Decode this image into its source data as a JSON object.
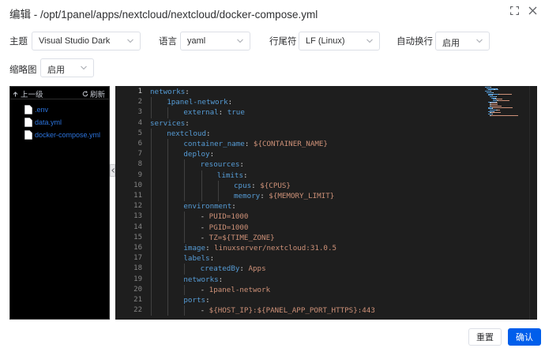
{
  "dialog": {
    "title": "编辑 - /opt/1panel/apps/nextcloud/nextcloud/docker-compose.yml"
  },
  "options": {
    "theme": {
      "label": "主题",
      "value": "Visual Studio Dark"
    },
    "language": {
      "label": "语言",
      "value": "yaml"
    },
    "eol": {
      "label": "行尾符",
      "value": "LF (Linux)"
    },
    "wrap": {
      "label": "自动换行",
      "value": "启用"
    },
    "minimap": {
      "label": "缩略图",
      "value": "启用"
    }
  },
  "tree": {
    "up_label": "上一级",
    "refresh_label": "刷新",
    "files": [
      {
        "name": ".env"
      },
      {
        "name": "data.yml"
      },
      {
        "name": "docker-compose.yml"
      }
    ]
  },
  "editor": {
    "active_line": 1,
    "lines": [
      {
        "no": "1",
        "indent": 0,
        "tokens": [
          {
            "t": "k",
            "v": "networks"
          },
          {
            "t": "p",
            "v": ":"
          }
        ]
      },
      {
        "no": "2",
        "indent": 1,
        "tokens": [
          {
            "t": "k",
            "v": "1panel-network"
          },
          {
            "t": "p",
            "v": ":"
          }
        ]
      },
      {
        "no": "3",
        "indent": 2,
        "tokens": [
          {
            "t": "k",
            "v": "external"
          },
          {
            "t": "p",
            "v": ": "
          },
          {
            "t": "b",
            "v": "true"
          }
        ]
      },
      {
        "no": "4",
        "indent": 0,
        "tokens": [
          {
            "t": "k",
            "v": "services"
          },
          {
            "t": "p",
            "v": ":"
          }
        ]
      },
      {
        "no": "5",
        "indent": 1,
        "tokens": [
          {
            "t": "k",
            "v": "nextcloud"
          },
          {
            "t": "p",
            "v": ":"
          }
        ]
      },
      {
        "no": "6",
        "indent": 2,
        "tokens": [
          {
            "t": "k",
            "v": "container_name"
          },
          {
            "t": "p",
            "v": ": "
          },
          {
            "t": "s",
            "v": "${CONTAINER_NAME}"
          }
        ]
      },
      {
        "no": "7",
        "indent": 2,
        "tokens": [
          {
            "t": "k",
            "v": "deploy"
          },
          {
            "t": "p",
            "v": ":"
          }
        ]
      },
      {
        "no": "8",
        "indent": 3,
        "tokens": [
          {
            "t": "k",
            "v": "resources"
          },
          {
            "t": "p",
            "v": ":"
          }
        ]
      },
      {
        "no": "9",
        "indent": 4,
        "tokens": [
          {
            "t": "k",
            "v": "limits"
          },
          {
            "t": "p",
            "v": ":"
          }
        ]
      },
      {
        "no": "10",
        "indent": 5,
        "tokens": [
          {
            "t": "k",
            "v": "cpus"
          },
          {
            "t": "p",
            "v": ": "
          },
          {
            "t": "s",
            "v": "${CPUS}"
          }
        ]
      },
      {
        "no": "11",
        "indent": 5,
        "tokens": [
          {
            "t": "k",
            "v": "memory"
          },
          {
            "t": "p",
            "v": ": "
          },
          {
            "t": "s",
            "v": "${MEMORY_LIMIT}"
          }
        ]
      },
      {
        "no": "12",
        "indent": 2,
        "tokens": [
          {
            "t": "k",
            "v": "environment"
          },
          {
            "t": "p",
            "v": ":"
          }
        ]
      },
      {
        "no": "13",
        "indent": 3,
        "tokens": [
          {
            "t": "p",
            "v": "- "
          },
          {
            "t": "s",
            "v": "PUID=1000"
          }
        ]
      },
      {
        "no": "14",
        "indent": 3,
        "tokens": [
          {
            "t": "p",
            "v": "- "
          },
          {
            "t": "s",
            "v": "PGID=1000"
          }
        ]
      },
      {
        "no": "15",
        "indent": 3,
        "tokens": [
          {
            "t": "p",
            "v": "- "
          },
          {
            "t": "s",
            "v": "TZ=${TIME_ZONE}"
          }
        ]
      },
      {
        "no": "16",
        "indent": 2,
        "tokens": [
          {
            "t": "k",
            "v": "image"
          },
          {
            "t": "p",
            "v": ": "
          },
          {
            "t": "s",
            "v": "linuxserver/nextcloud:31.0.5"
          }
        ]
      },
      {
        "no": "17",
        "indent": 2,
        "tokens": [
          {
            "t": "k",
            "v": "labels"
          },
          {
            "t": "p",
            "v": ":"
          }
        ]
      },
      {
        "no": "18",
        "indent": 3,
        "tokens": [
          {
            "t": "k",
            "v": "createdBy"
          },
          {
            "t": "p",
            "v": ": "
          },
          {
            "t": "s",
            "v": "Apps"
          }
        ]
      },
      {
        "no": "19",
        "indent": 2,
        "tokens": [
          {
            "t": "k",
            "v": "networks"
          },
          {
            "t": "p",
            "v": ":"
          }
        ]
      },
      {
        "no": "20",
        "indent": 3,
        "tokens": [
          {
            "t": "p",
            "v": "- "
          },
          {
            "t": "s",
            "v": "1panel-network"
          }
        ]
      },
      {
        "no": "21",
        "indent": 2,
        "tokens": [
          {
            "t": "k",
            "v": "ports"
          },
          {
            "t": "p",
            "v": ":"
          }
        ]
      },
      {
        "no": "22",
        "indent": 3,
        "tokens": [
          {
            "t": "p",
            "v": "- "
          },
          {
            "t": "s",
            "v": "${HOST_IP}:${PANEL_APP_PORT_HTTPS}:443"
          }
        ]
      }
    ]
  },
  "footer": {
    "reset_label": "重置",
    "confirm_label": "确认"
  },
  "colors": {
    "primary": "#005eeb",
    "editor_bg": "#1e1e1e",
    "key": "#569cd6",
    "string": "#ce9178"
  }
}
